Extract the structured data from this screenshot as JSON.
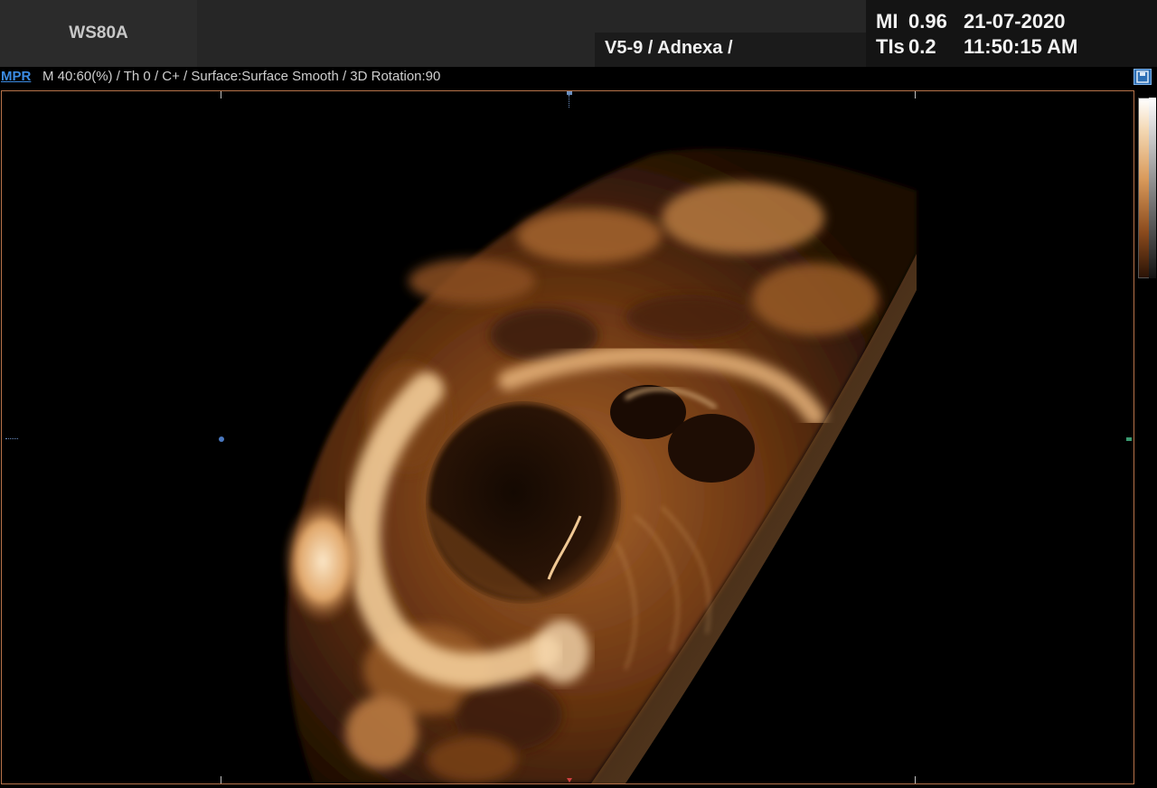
{
  "header": {
    "model": "WS80A",
    "probe_preset": "V5-9 / Adnexa /",
    "mi_label": "MI",
    "mi_value": "0.96",
    "tis_label": "TIs",
    "tis_value": "0.2",
    "date": "21-07-2020",
    "time": "11:50:15 AM"
  },
  "status": {
    "mode_tab": "MPR",
    "params": "M 40:60(%) / Th 0 / C+ / Surface:Surface Smooth / 3D Rotation:90"
  },
  "icons": {
    "save": "save-icon"
  },
  "colors": {
    "accent": "#3b8be3",
    "viewport_border": "#b8734a",
    "tint_bright": "#f6d9b0",
    "tint_mid": "#b4723c",
    "tint_dark": "#3a1c08"
  }
}
